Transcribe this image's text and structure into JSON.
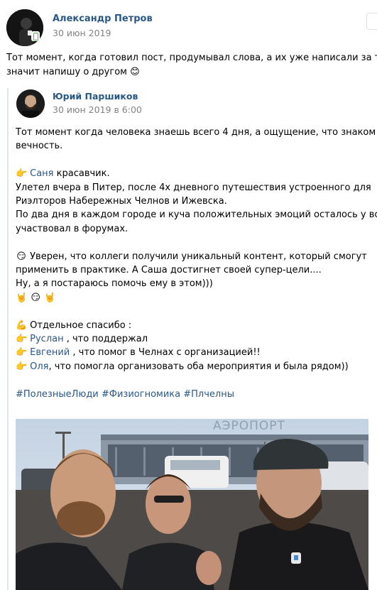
{
  "post": {
    "author": "Александр Петров",
    "date": "30 июн 2019",
    "text_lines": [
      "Тот момент, когда готовил пост, продумывал слова, а их уже написали за тебя 😏",
      "значит напишу о другом 😊"
    ]
  },
  "repost": {
    "author": "Юрий Паршиков",
    "date": "30 июн 2019 в 6:00",
    "p1_l1": "Тот момент когда человека знаешь всего 4 дня, а ощущение, что знаком",
    "p1_l2": "вечность.",
    "e_point": "👉",
    "e_smirk": "😏",
    "e_horns": "🤘",
    "e_muscle": "💪",
    "sanya_link": "Саня",
    "sanya_text": " красавчик.",
    "p2_l2": "Улетел вчера в Питер, после 4х дневного путешествия устроенного для",
    "p2_l3": "Риэлторов Набережных Челнов и Ижевска.",
    "p2_l4": "По два дня в каждом городе и куча положительных эмоций осталось у всех, кто",
    "p2_l5": "участвовал в форумах.",
    "p3_l1": " Уверен, что коллеги получили уникальный контент, который смогут",
    "p3_l2": "применить в практике. А Саша достигнет своей супер-цели....",
    "p3_l3": "Ну, а я постараюсь помочь ему в этом)))",
    "thanks": " Отдельное спасибо :",
    "ruslan_link": "Руслан",
    "ruslan_text": " , что поддержал",
    "evgeniy_link": "Евгений",
    "evgeniy_text": " , что помог в Челнах с организацией!!",
    "olya_link": "Оля",
    "olya_text": ", что помогла организовать оба мероприятия и была рядом))",
    "hashtags": "#ПолезныеЛюди #Физиогномика #Плчелны"
  },
  "photo": {
    "sign_text": "АЭРОПОРТ"
  }
}
